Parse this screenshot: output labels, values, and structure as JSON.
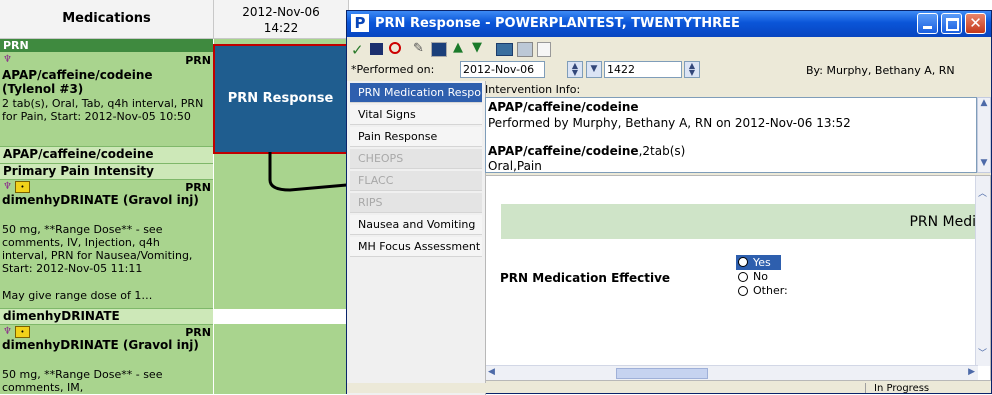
{
  "mar": {
    "col_header": "Medications",
    "time_header_date": "2012-Nov-06",
    "time_header_time": "14:22",
    "prn_section": "PRN",
    "meds": [
      {
        "prn": "PRN",
        "name": "APAP/caffeine/codeine",
        "brand": "(Tylenol #3)",
        "details": "2 tab(s), Oral, Tab, q4h interval, PRN for Pain, Start: 2012-Nov-05 10:50",
        "sub_name": "APAP/caffeine/codeine",
        "sub_label": "Primary Pain Intensity"
      },
      {
        "prn": "PRN",
        "name": "dimenhyDRINATE (Gravol inj)",
        "details": "50 mg, **Range Dose** - see comments, IV, Injection, q4h interval, PRN for Nausea/Vomiting, Start: 2012-Nov-05 11:11",
        "note": "May give range dose of 1…",
        "sub_name": "dimenhyDRINATE"
      },
      {
        "prn": "PRN",
        "name": "dimenhyDRINATE (Gravol inj)",
        "details": "50 mg, **Range Dose** - see comments, IM,"
      }
    ],
    "prn_response_cell": "PRN Response"
  },
  "dialog": {
    "title_icon": "P",
    "title": "PRN Response - POWERPLANTEST, TWENTYTHREE",
    "performed_label": "*Performed on:",
    "performed_date": "2012-Nov-06",
    "performed_time": "1422",
    "by_label": "By:  Murphy, Bethany A, RN",
    "nav": [
      {
        "label": "PRN Medication Response",
        "state": "selected"
      },
      {
        "label": "Vital Signs",
        "state": "normal"
      },
      {
        "label": "Pain Response",
        "state": "normal"
      },
      {
        "label": "CHEOPS",
        "state": "disabled"
      },
      {
        "label": "FLACC",
        "state": "disabled"
      },
      {
        "label": "RIPS",
        "state": "disabled"
      },
      {
        "label": "Nausea and Vomiting",
        "state": "normal"
      },
      {
        "label": "MH Focus Assessment",
        "state": "normal"
      }
    ],
    "intervention_label": "Intervention Info:",
    "intervention": {
      "med_name": "APAP/caffeine/codeine",
      "performed_by": "Performed by Murphy, Bethany A, RN on 2012-Nov-06 13:52",
      "med_dose_name": "APAP/caffeine/codeine",
      "med_dose": ",2tab(s)",
      "route": "Oral,Pain"
    },
    "section_header": "PRN Medi",
    "question": "PRN Medication Effective",
    "options": [
      "Yes",
      "No",
      "Other:"
    ],
    "selected_option": "Yes",
    "status": "In Progress"
  },
  "colors": {
    "mar_green": "#a9d48e",
    "selected_blue": "#2e5fae",
    "dialog_title_blue": "#0a55d8",
    "section_green": "#cfe4c8",
    "highlight_border": "#c00000"
  }
}
